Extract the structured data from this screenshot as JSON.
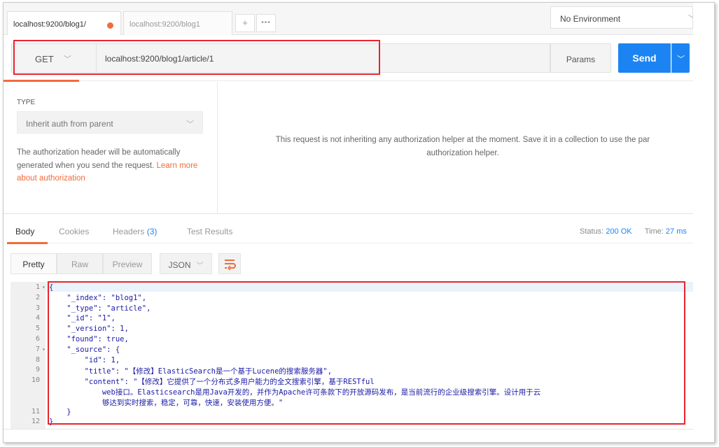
{
  "tabs": [
    {
      "label": "localhost:9200/blog1/",
      "active": true
    },
    {
      "label": "localhost:9200/blog1",
      "active": false
    }
  ],
  "tab_actions": {
    "new": "+",
    "more": "•••"
  },
  "environment": "No Environment",
  "request": {
    "method": "GET",
    "url": "localhost:9200/blog1/article/1",
    "params_label": "Params",
    "send_label": "Send"
  },
  "auth": {
    "type_label": "TYPE",
    "type_value": "Inherit auth from parent",
    "description": "The authorization header will be automatically generated when you send the request.",
    "learn_more": "Learn more about authorization",
    "message_line1": "This request is not inheriting any authorization helper at the moment. Save it in a collection to use the par",
    "message_line2": "authorization helper."
  },
  "response": {
    "tabs": {
      "body": "Body",
      "cookies": "Cookies",
      "headers": "Headers",
      "headers_count": "(3)",
      "tests": "Test Results"
    },
    "status_label": "Status:",
    "status_value": "200 OK",
    "time_label": "Time:",
    "time_value": "27 ms",
    "views": {
      "pretty": "Pretty",
      "raw": "Raw",
      "preview": "Preview",
      "format": "JSON"
    }
  },
  "code_lines": [
    {
      "n": "1",
      "fold": true,
      "text": "{"
    },
    {
      "n": "2",
      "text": "    \"_index\": \"blog1\","
    },
    {
      "n": "3",
      "text": "    \"_type\": \"article\","
    },
    {
      "n": "4",
      "text": "    \"_id\": \"1\","
    },
    {
      "n": "5",
      "text": "    \"_version\": 1,"
    },
    {
      "n": "6",
      "text": "    \"found\": true,"
    },
    {
      "n": "7",
      "fold": true,
      "text": "    \"_source\": {"
    },
    {
      "n": "8",
      "text": "        \"id\": 1,"
    },
    {
      "n": "9",
      "text": "        \"title\": \"【修改】ElasticSearch是一个基于Lucene的搜索服务器\","
    },
    {
      "n": "10",
      "text": "        \"content\": \"【修改】它提供了一个分布式多用户能力的全文搜索引擎，基于RESTful"
    },
    {
      "n": "",
      "text": "            web接口。Elasticsearch是用Java开发的，并作为Apache许可条款下的开放源码发布，是当前流行的企业级搜索引擎。设计用于云"
    },
    {
      "n": "",
      "text": "            够达到实时搜索，稳定，可靠，快速，安装使用方便。\""
    },
    {
      "n": "11",
      "text": "    }"
    },
    {
      "n": "12",
      "text": "}"
    }
  ]
}
